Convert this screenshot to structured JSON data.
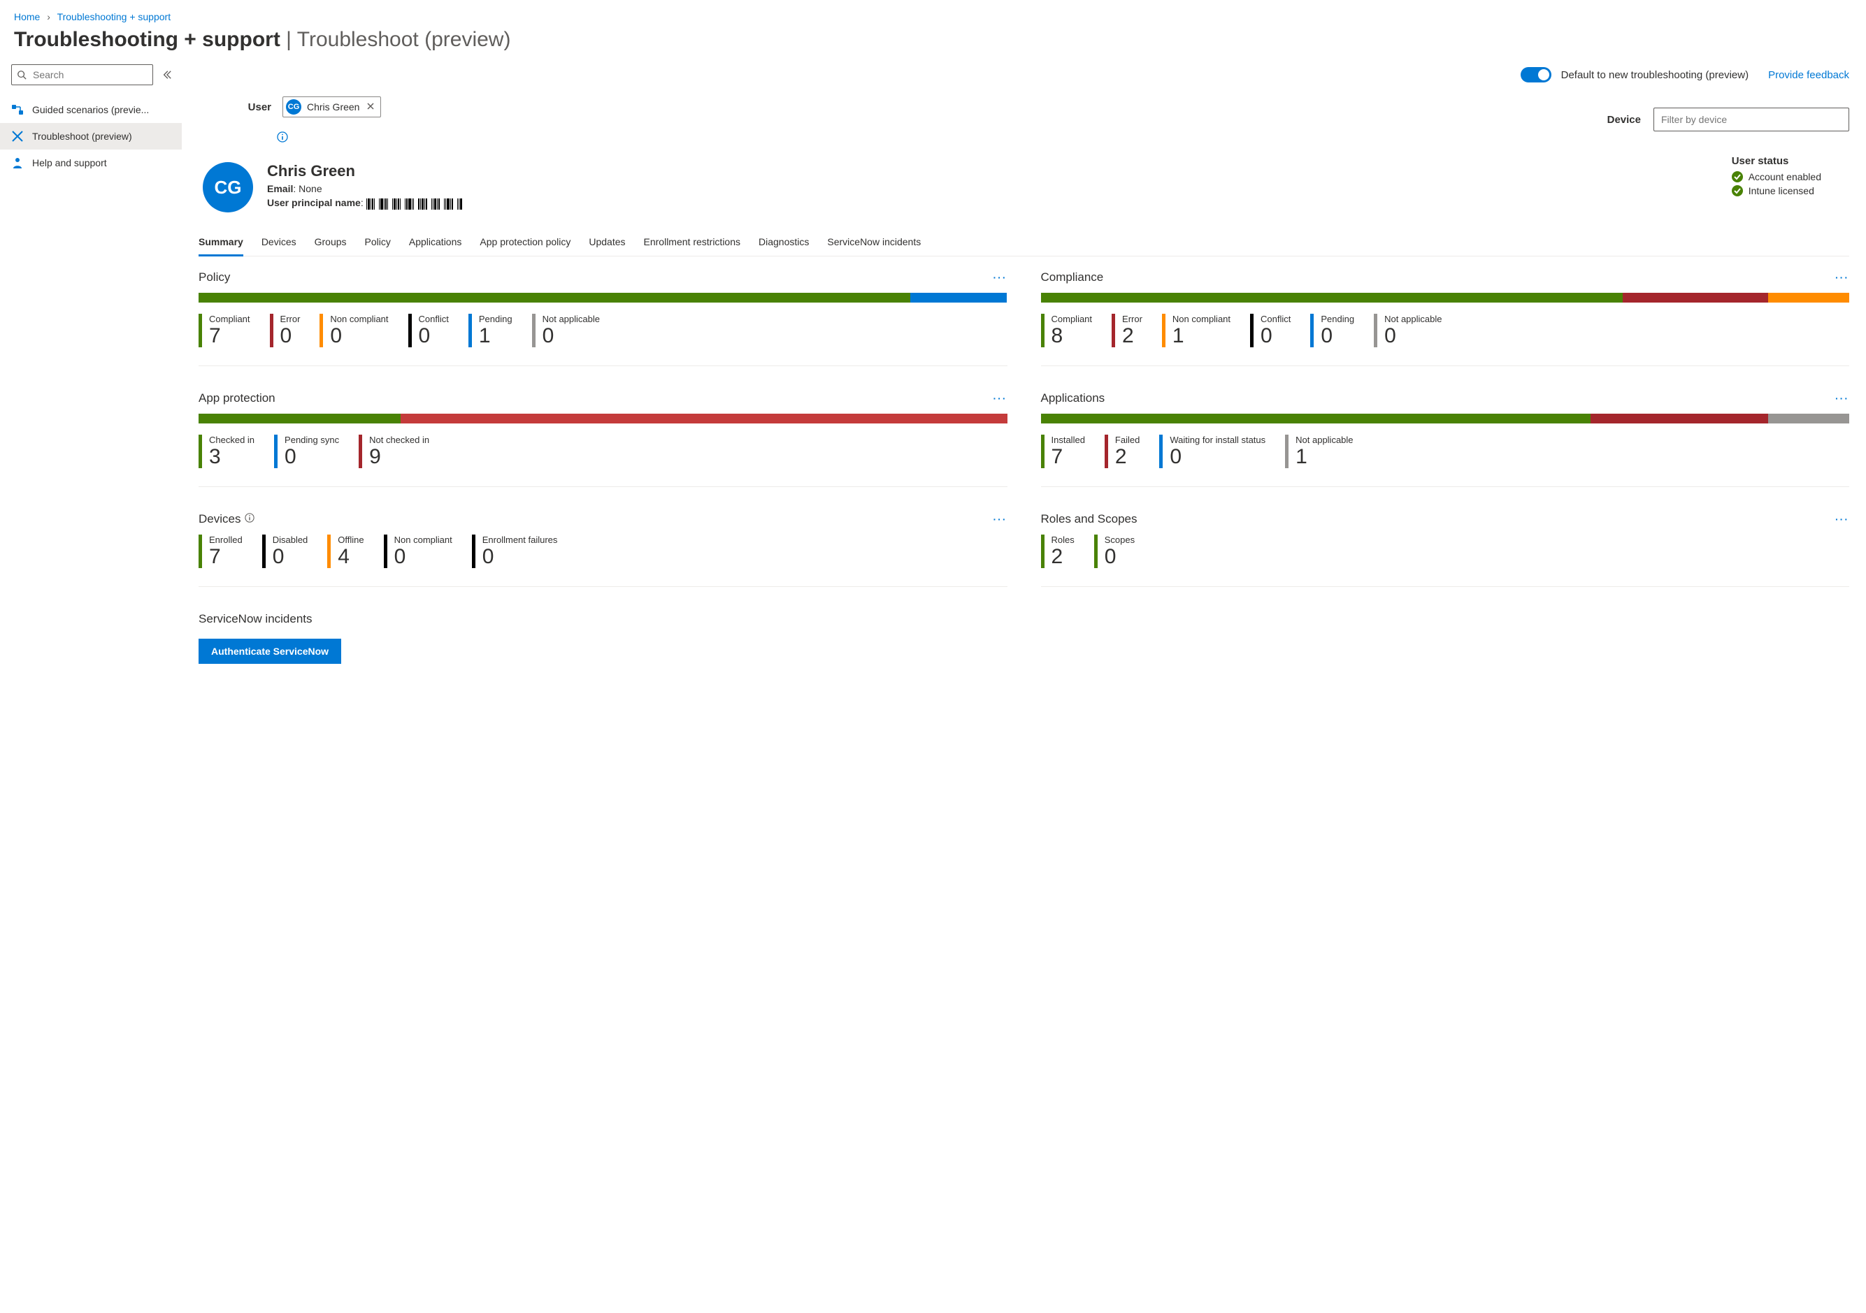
{
  "breadcrumb": {
    "home": "Home",
    "section": "Troubleshooting + support"
  },
  "pageTitle": {
    "main": "Troubleshooting + support",
    "sub": "Troubleshoot (preview)"
  },
  "sidebar": {
    "searchPlaceholder": "Search",
    "collapseTooltip": "Collapse",
    "items": [
      {
        "label": "Guided scenarios (previe..."
      },
      {
        "label": "Troubleshoot (preview)"
      },
      {
        "label": "Help and support"
      }
    ]
  },
  "topBar": {
    "toggleLabel": "Default to new troubleshooting (preview)",
    "feedback": "Provide feedback"
  },
  "userDevice": {
    "userLabel": "User",
    "deviceLabel": "Device",
    "devicePlaceholder": "Filter by device",
    "chip": {
      "initials": "CG",
      "name": "Chris Green"
    }
  },
  "userDetail": {
    "initials": "CG",
    "name": "Chris Green",
    "emailLabel": "Email",
    "emailValue": "None",
    "upnLabel": "User principal name"
  },
  "userStatus": {
    "title": "User status",
    "items": [
      "Account enabled",
      "Intune licensed"
    ]
  },
  "tabs": [
    "Summary",
    "Devices",
    "Groups",
    "Policy",
    "Applications",
    "App protection policy",
    "Updates",
    "Enrollment restrictions",
    "Diagnostics",
    "ServiceNow incidents"
  ],
  "colors": {
    "green": "#498205",
    "red": "#a4262c",
    "red2": "#c43b3b",
    "orange": "#ff8c00",
    "black": "#000000",
    "blue": "#0078d4",
    "gray": "#979593"
  },
  "cards": {
    "policy": {
      "title": "Policy",
      "segments": [
        {
          "colorClass": "c-green",
          "pct": 88
        },
        {
          "colorClass": "c-blue",
          "pct": 12
        }
      ],
      "stats": [
        {
          "label": "Compliant",
          "value": "7",
          "colorClass": "c-green"
        },
        {
          "label": "Error",
          "value": "0",
          "colorClass": "c-red"
        },
        {
          "label": "Non compliant",
          "value": "0",
          "colorClass": "c-orange"
        },
        {
          "label": "Conflict",
          "value": "0",
          "colorClass": "c-black"
        },
        {
          "label": "Pending",
          "value": "1",
          "colorClass": "c-blue"
        },
        {
          "label": "Not applicable",
          "value": "0",
          "colorClass": "c-gray"
        }
      ]
    },
    "compliance": {
      "title": "Compliance",
      "segments": [
        {
          "colorClass": "c-green",
          "pct": 72
        },
        {
          "colorClass": "c-red",
          "pct": 18
        },
        {
          "colorClass": "c-orange",
          "pct": 10
        }
      ],
      "stats": [
        {
          "label": "Compliant",
          "value": "8",
          "colorClass": "c-green"
        },
        {
          "label": "Error",
          "value": "2",
          "colorClass": "c-red"
        },
        {
          "label": "Non compliant",
          "value": "1",
          "colorClass": "c-orange"
        },
        {
          "label": "Conflict",
          "value": "0",
          "colorClass": "c-black"
        },
        {
          "label": "Pending",
          "value": "0",
          "colorClass": "c-blue"
        },
        {
          "label": "Not applicable",
          "value": "0",
          "colorClass": "c-gray"
        }
      ]
    },
    "appProtection": {
      "title": "App protection",
      "segments": [
        {
          "colorClass": "c-green",
          "pct": 25
        },
        {
          "colorClass": "c-red2",
          "pct": 75
        }
      ],
      "stats": [
        {
          "label": "Checked in",
          "value": "3",
          "colorClass": "c-green"
        },
        {
          "label": "Pending sync",
          "value": "0",
          "colorClass": "c-blue"
        },
        {
          "label": "Not checked in",
          "value": "9",
          "colorClass": "c-red"
        }
      ]
    },
    "applications": {
      "title": "Applications",
      "segments": [
        {
          "colorClass": "c-green",
          "pct": 68
        },
        {
          "colorClass": "c-red",
          "pct": 22
        },
        {
          "colorClass": "c-gray",
          "pct": 10
        }
      ],
      "stats": [
        {
          "label": "Installed",
          "value": "7",
          "colorClass": "c-green"
        },
        {
          "label": "Failed",
          "value": "2",
          "colorClass": "c-red"
        },
        {
          "label": "Waiting for install status",
          "value": "0",
          "colorClass": "c-blue"
        },
        {
          "label": "Not applicable",
          "value": "1",
          "colorClass": "c-gray"
        }
      ]
    },
    "devices": {
      "title": "Devices",
      "stats": [
        {
          "label": "Enrolled",
          "value": "7",
          "colorClass": "c-green"
        },
        {
          "label": "Disabled",
          "value": "0",
          "colorClass": "c-black"
        },
        {
          "label": "Offline",
          "value": "4",
          "colorClass": "c-orange"
        },
        {
          "label": "Non compliant",
          "value": "0",
          "colorClass": "c-black"
        },
        {
          "label": "Enrollment failures",
          "value": "0",
          "colorClass": "c-black"
        }
      ]
    },
    "rolesScopes": {
      "title": "Roles and Scopes",
      "stats": [
        {
          "label": "Roles",
          "value": "2",
          "colorClass": "c-green"
        },
        {
          "label": "Scopes",
          "value": "0",
          "colorClass": "c-green"
        }
      ]
    }
  },
  "serviceNow": {
    "title": "ServiceNow incidents",
    "button": "Authenticate ServiceNow"
  }
}
